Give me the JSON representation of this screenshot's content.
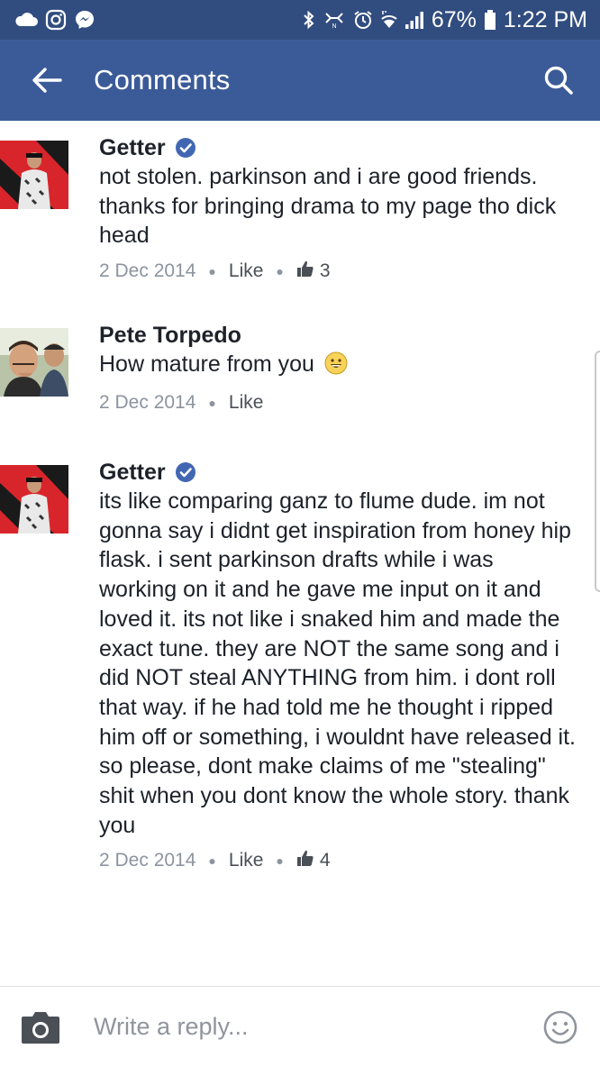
{
  "status_bar": {
    "battery": "67%",
    "time": "1:22 PM"
  },
  "header": {
    "title": "Comments"
  },
  "comments": [
    {
      "name": "Getter",
      "verified": true,
      "text": "not stolen. parkinson and i are good friends. thanks for bringing drama to my page tho dick head",
      "date": "2 Dec 2014",
      "like_label": "Like",
      "like_count": "3"
    },
    {
      "name": "Pete Torpedo",
      "verified": false,
      "text": "How mature from you",
      "date": "2 Dec 2014",
      "like_label": "Like"
    },
    {
      "name": "Getter",
      "verified": true,
      "text": "its like comparing ganz to flume dude. im not gonna say i didnt get inspiration from honey hip flask. i sent parkinson drafts while i was working on it and he gave me input on it and loved it. its not like i snaked him and made the exact tune. they are NOT the same song and i did NOT steal ANYTHING from him. i dont roll that way. if he had told me he thought i ripped him off or something, i wouldnt have released it. so please, dont make claims of me \"stealing\" shit when you dont know the whole story. thank you",
      "date": "2 Dec 2014",
      "like_label": "Like",
      "like_count": "4"
    }
  ],
  "reply": {
    "placeholder": "Write a reply..."
  },
  "colors": {
    "status_bar": "#314d7f",
    "app_bar": "#3b5b98",
    "verified": "#4267b2",
    "meta_text": "#8d949e"
  }
}
